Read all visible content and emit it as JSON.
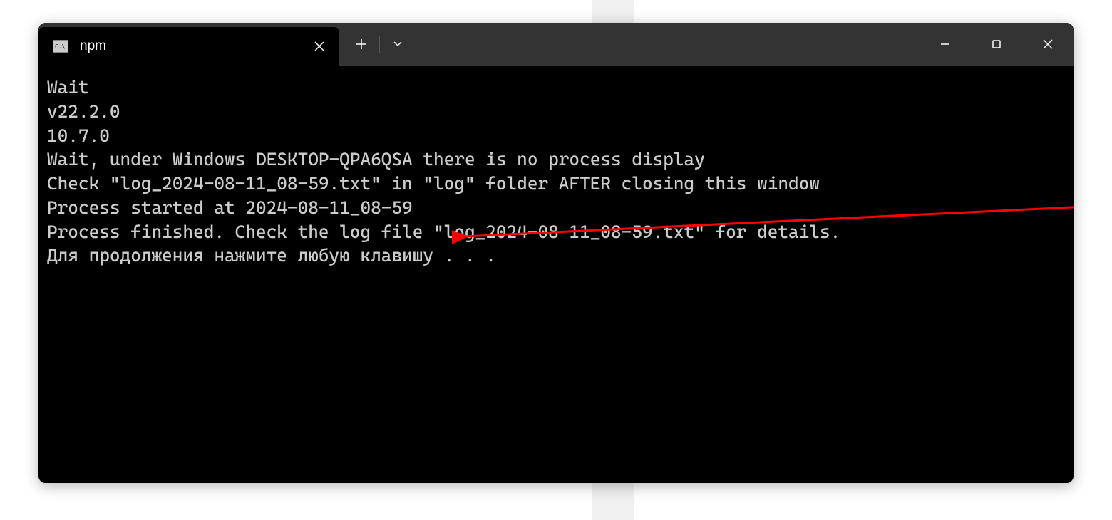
{
  "window": {
    "tab_title": "npm"
  },
  "terminal": {
    "lines": [
      "Wait",
      "v22.2.0",
      "10.7.0",
      "Wait, under Windows DESKTOP-QPA6QSA there is no process display",
      "Check \"log_2024-08-11_08-59.txt\" in \"log\" folder AFTER closing this window",
      "Process started at 2024-08-11_08-59",
      "Process finished. Check the log file \"log_2024-08-11_08-59.txt\" for details.",
      "Для продолжения нажмите любую клавишу . . ."
    ]
  },
  "colors": {
    "terminal_bg": "#000000",
    "titlebar_bg": "#333333",
    "text": "#cccccc",
    "arrow": "#ff0000"
  }
}
